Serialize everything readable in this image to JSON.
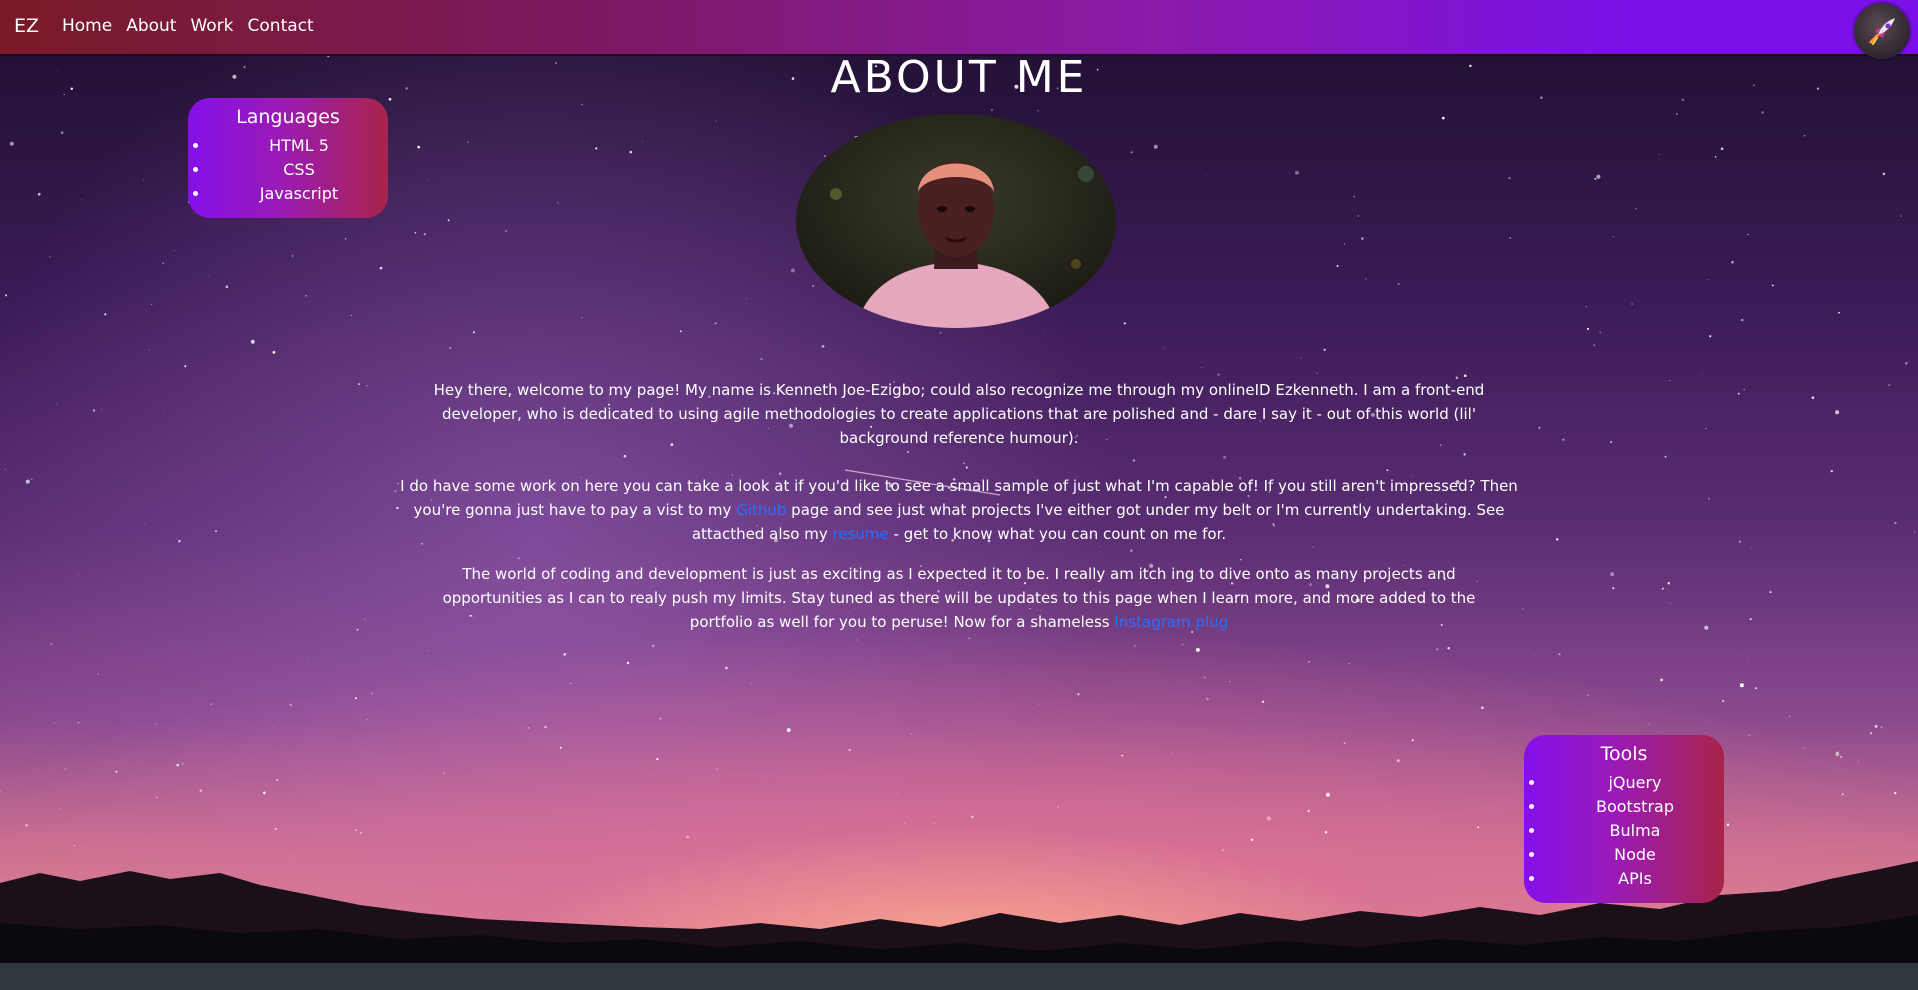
{
  "nav": {
    "brand": "EZ",
    "links": [
      "Home",
      "About",
      "Work",
      "Contact"
    ]
  },
  "page": {
    "title": "ABOUT ME"
  },
  "languages": {
    "title": "Languages",
    "items": [
      "HTML 5",
      "CSS",
      "Javascript"
    ]
  },
  "tools": {
    "title": "Tools",
    "items": [
      "jQuery",
      "Bootstrap",
      "Bulma",
      "Node",
      "APIs"
    ]
  },
  "about": {
    "p1": "Hey there, welcome to my page! My name is Kenneth Joe-Ezigbo; could also recognize me through my onlineID Ezkenneth. I am a front-end developer, who is dedicated to using agile methodologies to create applications that are polished and - dare I say it - out of this world (lil' background reference humour).",
    "p2_a": "I do have some work on here you can take a look at if you'd like to see a small sample of just what I'm capable of! If you still aren't impressed? Then you're gonna just have to pay a vist to my ",
    "p2_link1": "Github",
    "p2_b": " page and see just what projects I've either got under my belt or I'm currently undertaking. See attacthed also my ",
    "p2_link2": "resume",
    "p2_c": " - get to know what you can count on me for.",
    "p3_a": "The world of coding and development is just as exciting as I expected it to be. I really am itch ing to dive onto as many projects and opportunities as I can to realy push my limits. Stay tuned as there will be updates to this page when I learn more, and more added to the portfolio as well for you to peruse! Now for a shameless ",
    "p3_link": "Instagram plug"
  },
  "colors": {
    "link": "#2a6cff",
    "nav_start": "#7a1a26",
    "nav_end": "#7b0fe8",
    "card_start": "#8410ea",
    "card_end": "#a8244a"
  },
  "icons": {
    "rocket": "rocket-icon"
  }
}
